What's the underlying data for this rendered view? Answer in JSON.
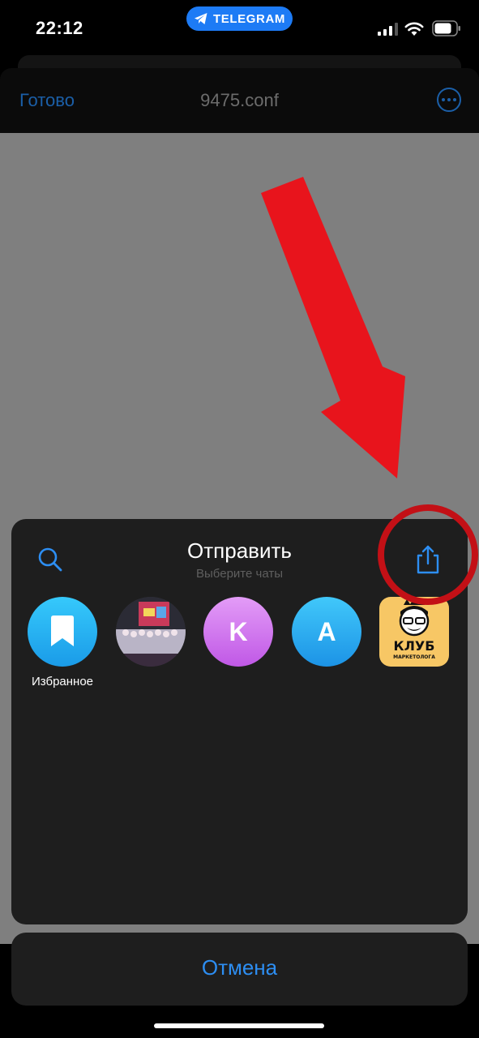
{
  "status_bar": {
    "time": "22:12",
    "app_pill": "TELEGRAM"
  },
  "nav_bar": {
    "done_label": "Готово",
    "title": "9475.conf"
  },
  "share_sheet": {
    "title": "Отправить",
    "subtitle": "Выберите чаты",
    "contacts": [
      {
        "name": "Избранное",
        "icon": "bookmark-icon"
      },
      {
        "name": "",
        "icon": "group-photo"
      },
      {
        "name": "",
        "initial": "K"
      },
      {
        "name": "",
        "initial": "A"
      },
      {
        "name": "",
        "logo_text": "КЛУБ",
        "logo_subtext": "МАРКЕТОЛОГА"
      }
    ]
  },
  "cancel_label": "Отмена",
  "colors": {
    "accent_blue": "#2d8ef2",
    "annotation_red": "#e8141c",
    "pill_blue": "#1d7bf5"
  }
}
